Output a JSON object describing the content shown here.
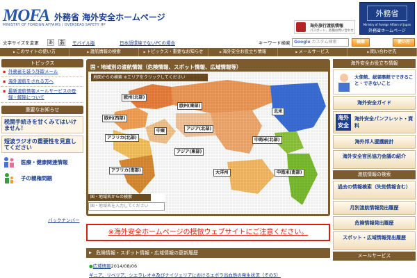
{
  "header": {
    "logo_text": "MOFA",
    "logo_sub": "MINISTRY OF FOREIGN AFFAIRS / OVERSEAS SAFETY HP",
    "site_title": "外務省 海外安全ホームページ",
    "banner_line1": "海外旅行渡航情報",
    "banner_line2": "パスポート、各種お問い合わせ",
    "mofa_jp": "外務省",
    "mofa_en": "Ministry of Foreign Affairs of Japan",
    "mofa_sub": "外務省ホームページ"
  },
  "utility": {
    "font_size_label": "文字サイズを変更",
    "font_small": "あ",
    "font_large": "あ",
    "mobile_link": "モバイル版",
    "pc_link": "日本語環境でないPCの場合",
    "keyword_label": "キーワード検索",
    "search_brand": "Google",
    "search_placeholder": "カスタム検索",
    "search_button": "検索",
    "howto_button": "使い方"
  },
  "nav": [
    "このサイトの使い方",
    "渡航情報の検索",
    "トピックス・重要なお知らせ",
    "海外安全お役立ち情報",
    "メールサービス",
    "問い合わせ先"
  ],
  "left": {
    "topics_head": "トピックス",
    "topics": [
      {
        "text": "外務省を装う詐欺メール",
        "badge": ""
      },
      {
        "text": "海外渡航をされる方へ",
        "badge": ""
      },
      {
        "text": "最新渡航情報メールサービスの登録・解除について",
        "badge": ""
      }
    ],
    "notice_head": "重要なお知らせ",
    "notices": [
      "税関手続きを甘くみてはいけません！",
      "短波ラジオの重要性を見直してください"
    ],
    "links": [
      "医療・健康関連情報",
      "子の親権問題"
    ],
    "back_number": "バックナンバー"
  },
  "map": {
    "title": "国・地域別の渡航情報（危険情報、スポット情報、広域情報等）",
    "sub_title": "地図からの検索 ※エリアをクリックしてください",
    "regions": [
      "欧州(北部)",
      "欧州(東部)",
      "欧州(西部)",
      "中東",
      "アジア(北部)",
      "アフリカ(北部)",
      "アジア(東部)",
      "アフリカ(南部)",
      "大洋州",
      "北米",
      "中南米(北部)",
      "中南米(南部)"
    ],
    "country_search_head": "国・地域名からの検索",
    "country_search_placeholder": "国・地域名を入力してください"
  },
  "warning": "※海外安全ホームページの模倣ウェブサイトにご注意ください。",
  "history": {
    "head": "危険情報・スポット情報・広域情報の更新履歴",
    "date": "2014/08/06",
    "category": "広域情報",
    "item": "ギニア、リベリア、シエラレオネ及びナイジェリアにおけるエボラ出血熱の発生状況（その5）"
  },
  "right": {
    "head": "海外安全お役立ち情報",
    "ad_text": "大使館、総領事館でできること・できないこと",
    "buttons": [
      "海外安全ガイド",
      "海外安全パンフレット・資料",
      "海外邦人援護統計",
      "海外安全官民協力会議の紹介"
    ],
    "pamphlet_icon": "海外安全",
    "search_head": "渡航情報の検索",
    "search_buttons": [
      "過去の情報検索（失効情報含む）",
      "月別渡航情報発出履歴",
      "危険情報発出履歴",
      "スポット・広域情報発出履歴"
    ],
    "mail_head": "メールサービス"
  },
  "colors": {
    "nav_brown": "#7c5b2e",
    "link_blue": "#1a3d8c",
    "warning_red": "#d81e05",
    "map_orange": "#f08a4b",
    "map_blue": "#3b6fd8",
    "map_green": "#8fc63d"
  }
}
